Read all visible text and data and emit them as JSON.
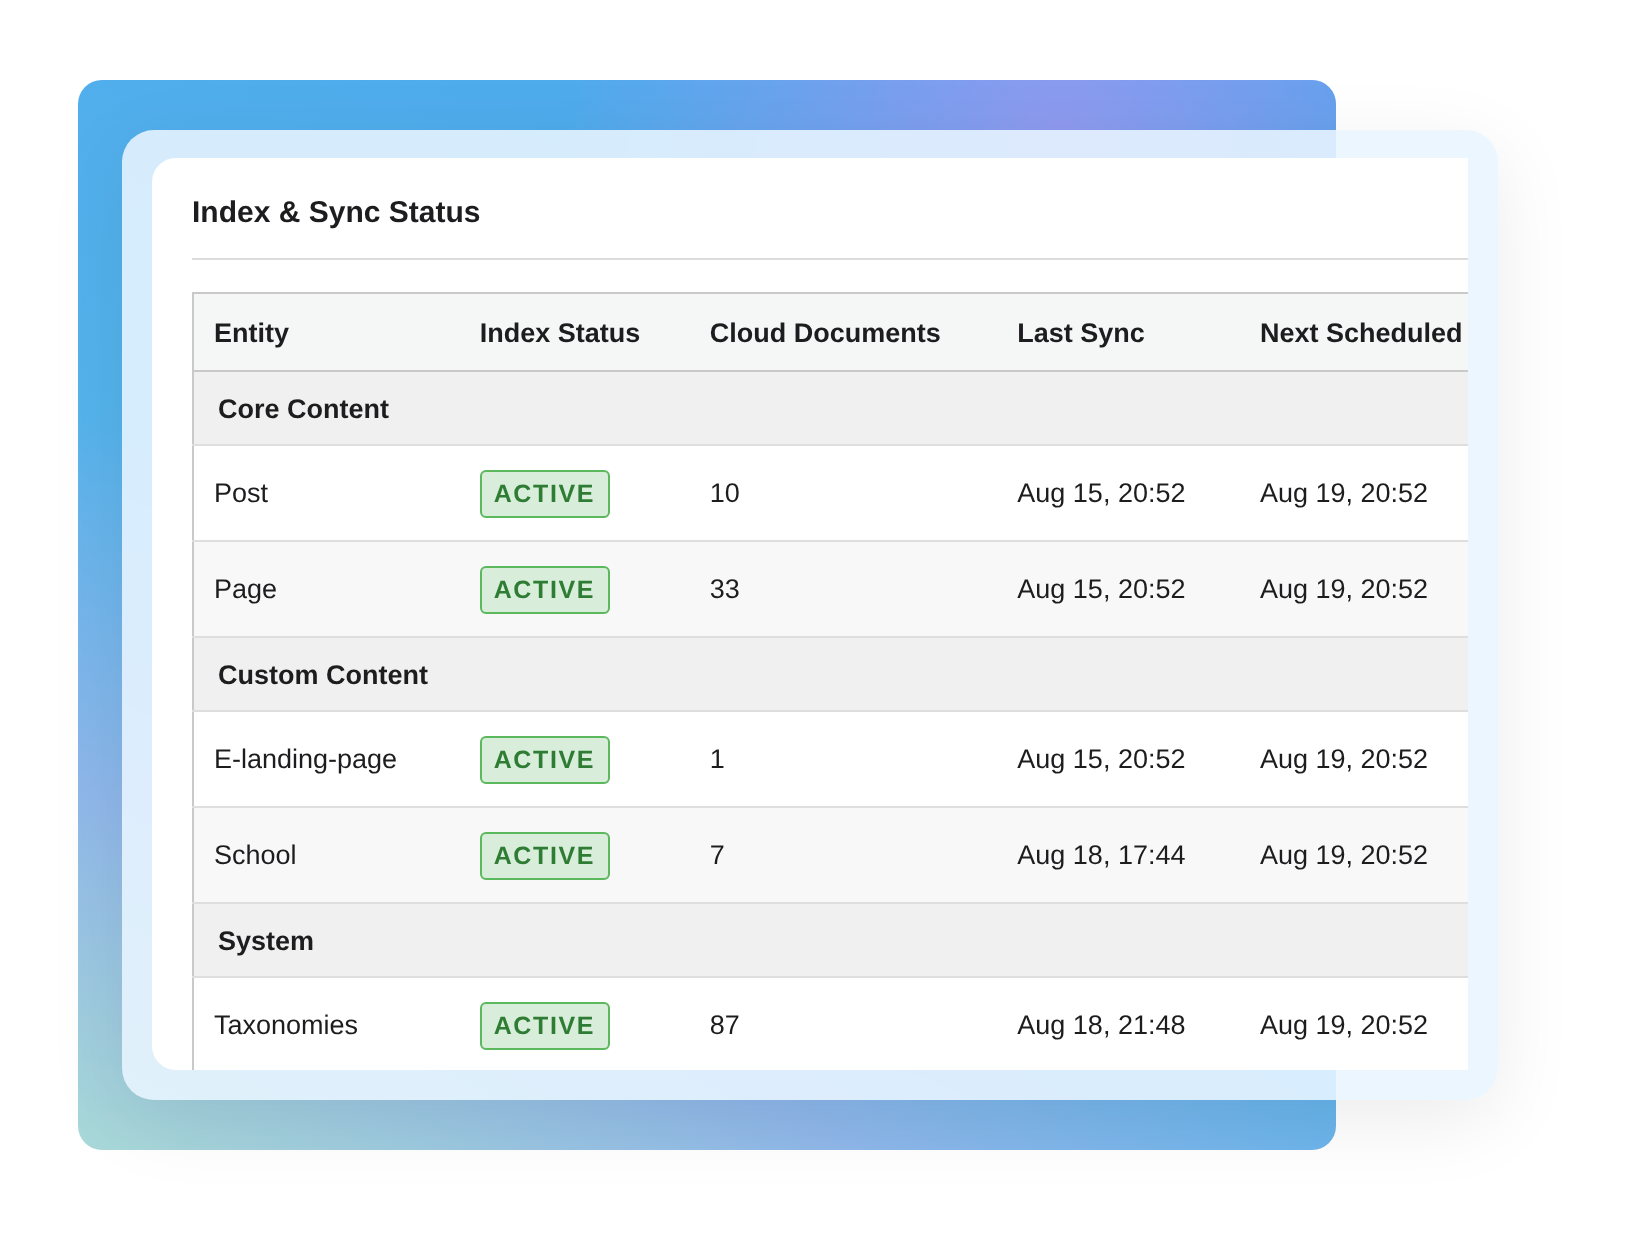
{
  "card": {
    "title": "Index & Sync Status"
  },
  "table": {
    "columns": [
      "Entity",
      "Index Status",
      "Cloud Documents",
      "Last Sync",
      "Next Scheduled"
    ],
    "groups": [
      {
        "name": "Core Content",
        "rows": [
          {
            "cells": [
              "Post",
              "ACTIVE",
              "10",
              "Aug 15, 20:52",
              "Aug 19, 20:52"
            ]
          },
          {
            "cells": [
              "Page",
              "ACTIVE",
              "33",
              "Aug 15, 20:52",
              "Aug 19, 20:52"
            ]
          }
        ]
      },
      {
        "name": "Custom Content",
        "rows": [
          {
            "cells": [
              "E-landing-page",
              "ACTIVE",
              "1",
              "Aug 15, 20:52",
              "Aug 19, 20:52"
            ]
          },
          {
            "cells": [
              "School",
              "ACTIVE",
              "7",
              "Aug 18, 17:44",
              "Aug 19, 20:52"
            ]
          }
        ]
      },
      {
        "name": "System",
        "rows": [
          {
            "cells": [
              "Taxonomies",
              "ACTIVE",
              "87",
              "Aug 18, 21:48",
              "Aug 19, 20:52"
            ]
          }
        ]
      }
    ]
  }
}
